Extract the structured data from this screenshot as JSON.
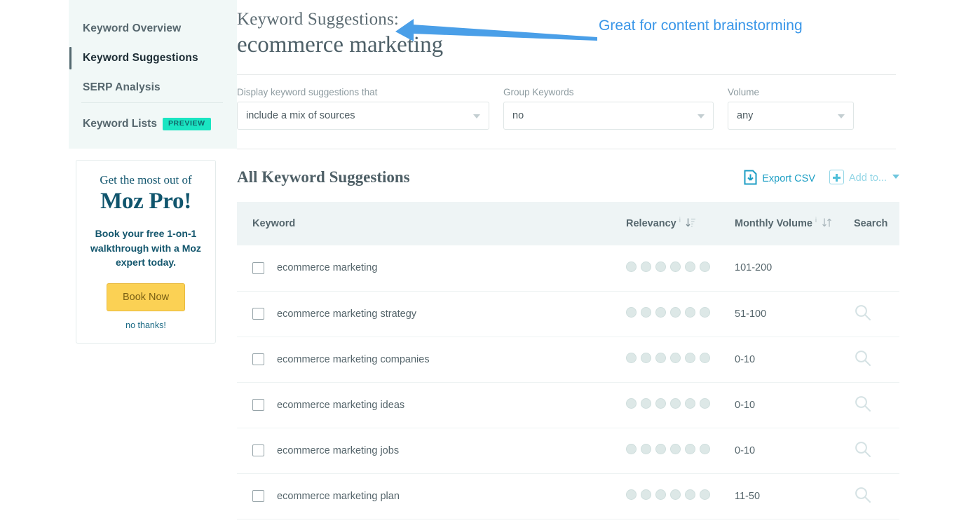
{
  "sidebar": {
    "items": [
      {
        "label": "Keyword Overview",
        "active": false
      },
      {
        "label": "Keyword Suggestions",
        "active": true
      },
      {
        "label": "SERP Analysis",
        "active": false
      }
    ],
    "lists_label": "Keyword Lists",
    "preview_badge": "PREVIEW",
    "active_accent": "#53686f",
    "badge_color": "#1ae5c2",
    "panel_bg": "#f1f8f7"
  },
  "promo": {
    "pre_title": "Get the most out of",
    "title": "Moz Pro!",
    "body": "Book your free 1-on-1 walkthrough with a Moz expert today.",
    "cta_label": "Book Now",
    "dismiss_label": "no thanks!",
    "cta_color": "#fbd154",
    "text_color": "#13566d"
  },
  "header": {
    "kicker": "Keyword Suggestions:",
    "keyword": "ecommerce marketing"
  },
  "annotation": {
    "text": "Great for content brainstorming",
    "color": "#3996e8",
    "arrow": "left-pointing-arrow"
  },
  "filters": [
    {
      "label": "Display keyword suggestions that",
      "value": "include a mix of sources",
      "name": "sources-filter"
    },
    {
      "label": "Group Keywords",
      "value": "no",
      "name": "group-keywords-filter"
    },
    {
      "label": "Volume",
      "value": "any",
      "name": "volume-filter"
    }
  ],
  "toolbar": {
    "table_title": "All Keyword Suggestions",
    "export_label": "Export CSV",
    "add_to_label": "Add to...",
    "export_color": "#1c9ec4",
    "add_to_color": "#93d6e6"
  },
  "table": {
    "columns": [
      {
        "label": "Keyword",
        "info": false,
        "sort": "none"
      },
      {
        "label": "Relevancy",
        "info": true,
        "sort": "desc"
      },
      {
        "label": "Monthly Volume",
        "info": true,
        "sort": "both"
      },
      {
        "label": "Search",
        "info": false,
        "sort": "none"
      }
    ],
    "info_glyph": "i",
    "rows": [
      {
        "keyword": "ecommerce marketing",
        "relevancy_dots": 6,
        "relevancy_filled": 0,
        "volume": "101-200",
        "has_search": false
      },
      {
        "keyword": "ecommerce marketing strategy",
        "relevancy_dots": 6,
        "relevancy_filled": 0,
        "volume": "51-100",
        "has_search": true
      },
      {
        "keyword": "ecommerce marketing companies",
        "relevancy_dots": 6,
        "relevancy_filled": 0,
        "volume": "0-10",
        "has_search": true
      },
      {
        "keyword": "ecommerce marketing ideas",
        "relevancy_dots": 6,
        "relevancy_filled": 0,
        "volume": "0-10",
        "has_search": true
      },
      {
        "keyword": "ecommerce marketing jobs",
        "relevancy_dots": 6,
        "relevancy_filled": 0,
        "volume": "0-10",
        "has_search": true
      },
      {
        "keyword": "ecommerce marketing plan",
        "relevancy_dots": 6,
        "relevancy_filled": 0,
        "volume": "11-50",
        "has_search": true
      }
    ]
  }
}
